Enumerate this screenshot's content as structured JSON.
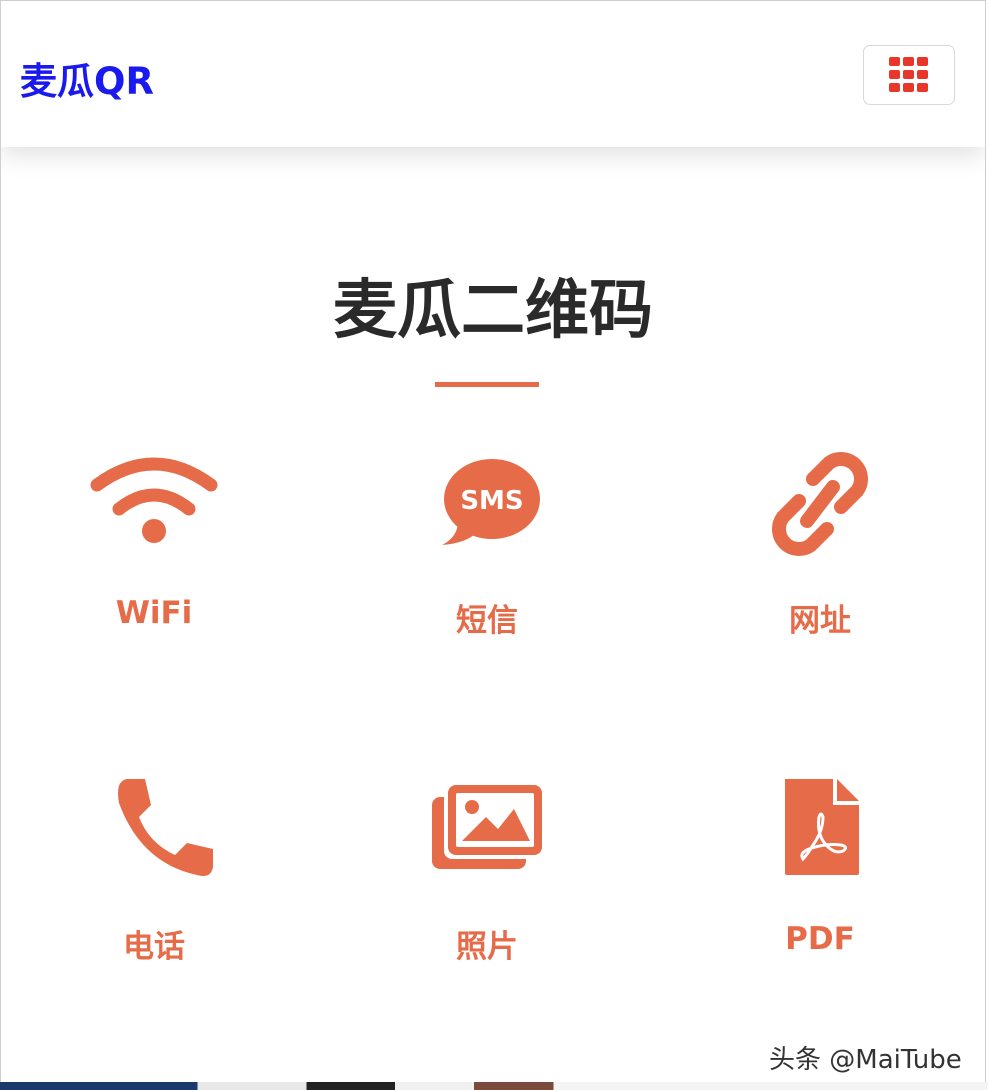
{
  "navbar": {
    "brand": "麦瓜QR",
    "menu_icon": "grid-icon"
  },
  "main": {
    "title": "麦瓜二维码",
    "tiles": [
      {
        "label": "WiFi",
        "icon": "wifi-icon"
      },
      {
        "label": "短信",
        "icon": "sms-bubble-icon",
        "icon_text": "SMS"
      },
      {
        "label": "网址",
        "icon": "link-icon"
      },
      {
        "label": "电话",
        "icon": "phone-icon"
      },
      {
        "label": "照片",
        "icon": "photos-icon"
      },
      {
        "label": "PDF",
        "icon": "pdf-file-icon"
      }
    ]
  },
  "watermark": "头条 @MaiTube",
  "colors": {
    "accent": "#e66b48",
    "brand": "#1a1aee",
    "grid_icon": "#e8372a",
    "title": "#2a2a2a"
  }
}
